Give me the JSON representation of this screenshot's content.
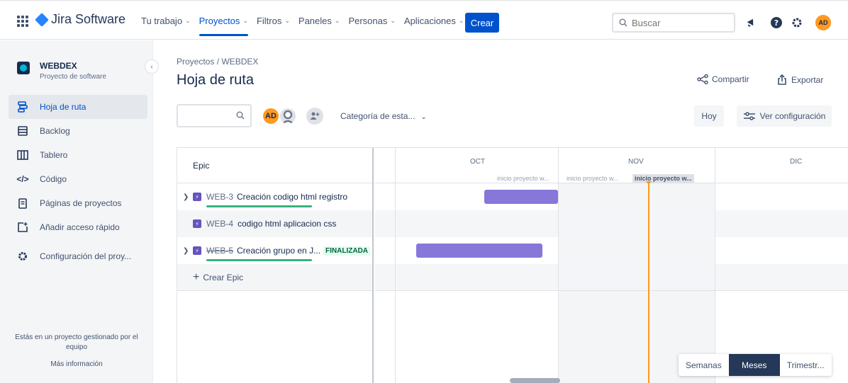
{
  "topnav": {
    "logo": "Jira Software",
    "items": [
      {
        "label": "Tu trabajo"
      },
      {
        "label": "Proyectos"
      },
      {
        "label": "Filtros"
      },
      {
        "label": "Paneles"
      },
      {
        "label": "Personas"
      },
      {
        "label": "Aplicaciones"
      }
    ],
    "create_label": "Crear",
    "search_placeholder": "Buscar",
    "user_initials": "AD",
    "colors": {
      "primary": "#0052cc",
      "avatar": "#ff991f"
    }
  },
  "sidebar": {
    "project_name": "WEBDEX",
    "project_type": "Proyecto de software",
    "items": [
      {
        "label": "Hoja de ruta",
        "icon": "roadmap-icon"
      },
      {
        "label": "Backlog",
        "icon": "backlog-icon"
      },
      {
        "label": "Tablero",
        "icon": "board-icon"
      },
      {
        "label": "Código",
        "icon": "code-icon"
      },
      {
        "label": "Páginas de proyectos",
        "icon": "page-icon"
      },
      {
        "label": "Añadir acceso rápido",
        "icon": "add-shortcut-icon"
      },
      {
        "label": "Configuración del proy...",
        "icon": "gear-icon"
      }
    ],
    "footer_text": "Estás en un proyecto gestionado por el equipo",
    "footer_link": "Más información"
  },
  "main": {
    "breadcrumb": "Proyectos  /  WEBDEX",
    "title": "Hoja de ruta",
    "share_label": "Compartir",
    "export_label": "Exportar",
    "avatar_initials": "AD",
    "category_label": "Categoría de esta...",
    "today_label": "Hoy",
    "view_settings_label": "Ver configuración"
  },
  "roadmap": {
    "epic_header": "Epic",
    "months": [
      "OCT",
      "NOV",
      "DIC"
    ],
    "markers": [
      "inicio proyecto w...",
      "inicio proyecto w...",
      "inicio proyecto w..."
    ],
    "epics": [
      {
        "key": "WEB-3",
        "title": "Creación codigo html registro",
        "expandable": true,
        "done": false,
        "progress": true
      },
      {
        "key": "WEB-4",
        "title": "codigo html aplicacion css",
        "expandable": false,
        "done": false,
        "progress": false
      },
      {
        "key": "WEB-5",
        "title": "Creación grupo en J...",
        "expandable": true,
        "done": true,
        "status": "FINALIZADA",
        "progress": true
      }
    ],
    "create_epic_label": "Crear Epic",
    "scale_options": [
      "Semanas",
      "Meses",
      "Trimestr..."
    ],
    "scale_selected": "Meses",
    "bar_color": "#8777d9",
    "today_color": "#ff991f"
  }
}
